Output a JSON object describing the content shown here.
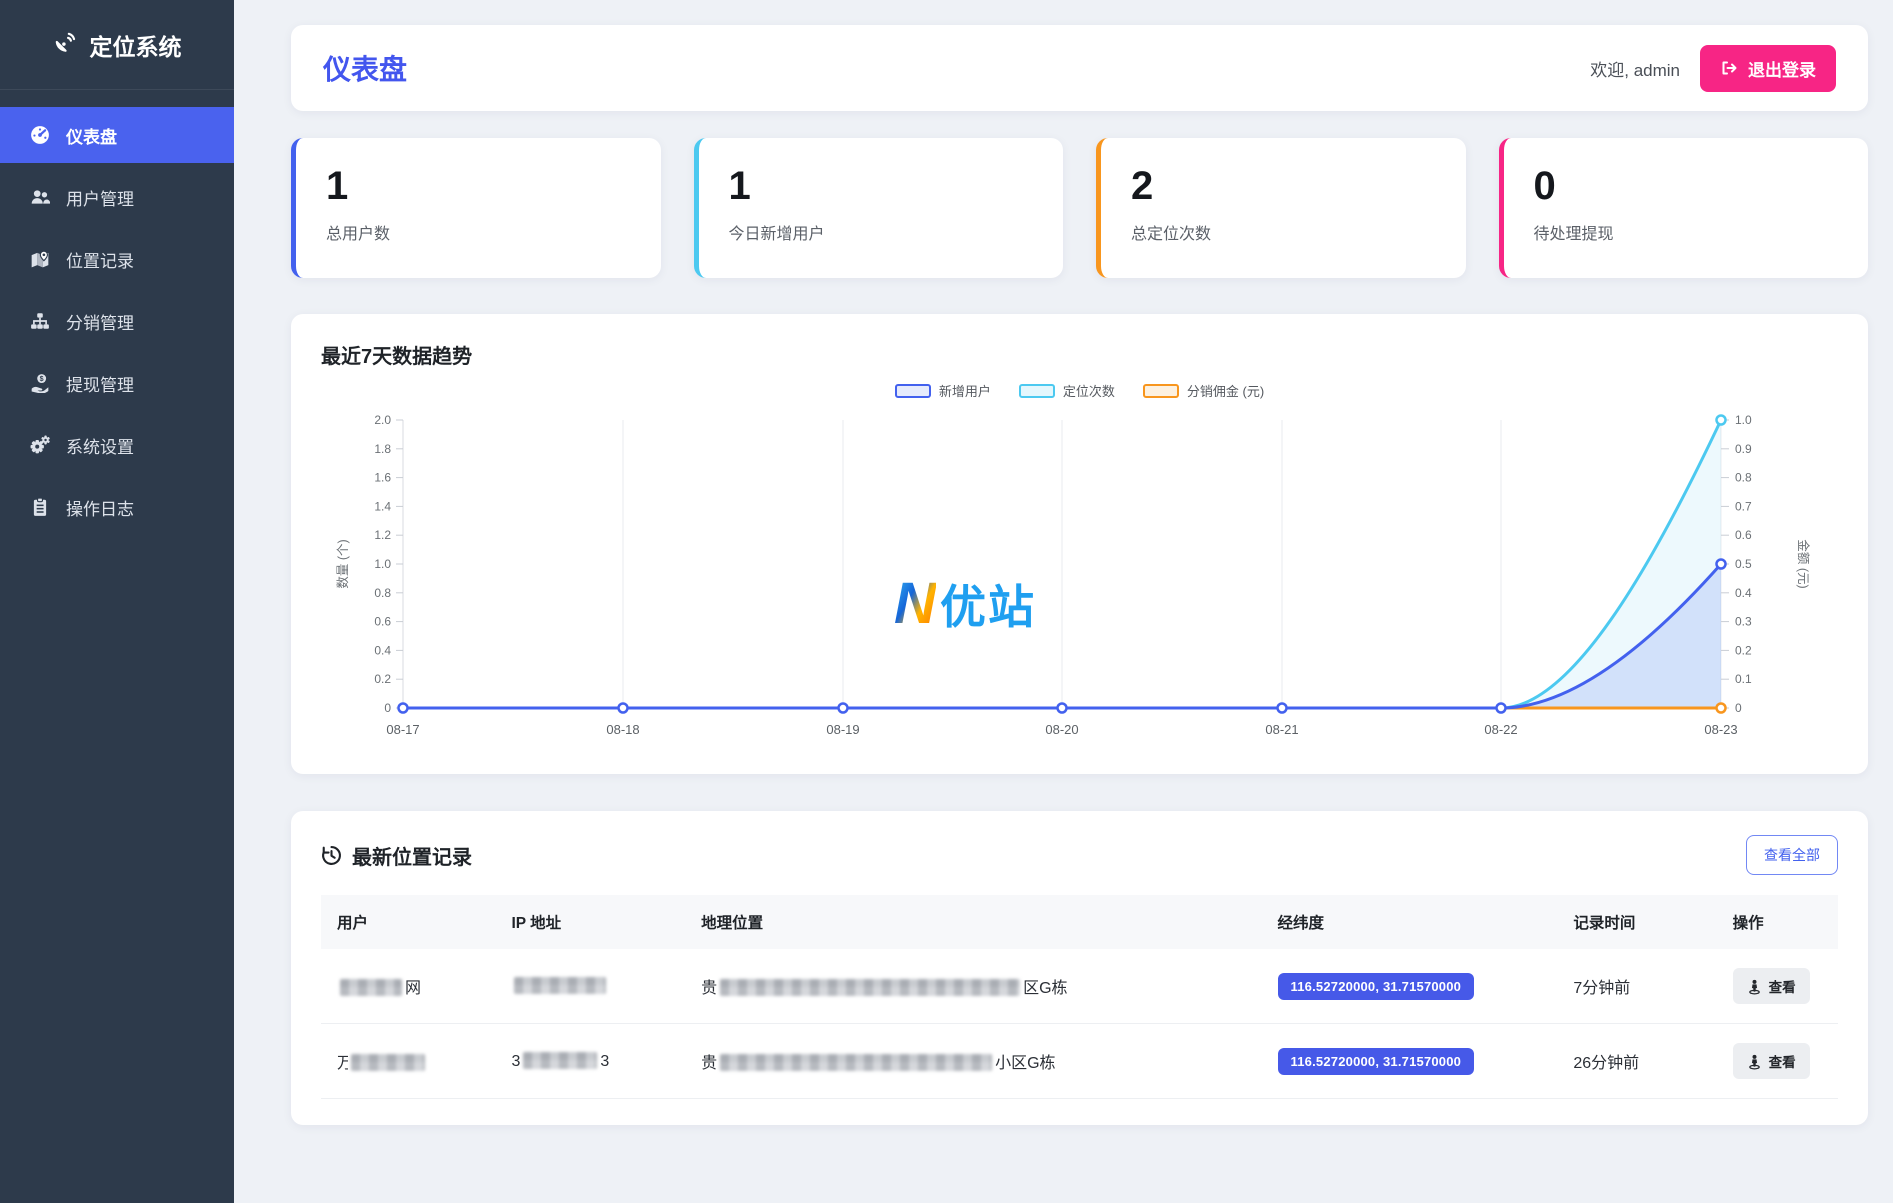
{
  "app": {
    "name": "定位系统",
    "logo_icon": "satellite-dish-icon"
  },
  "sidebar": {
    "items": [
      {
        "label": "仪表盘",
        "icon": "gauge-icon",
        "active": true
      },
      {
        "label": "用户管理",
        "icon": "users-icon",
        "active": false
      },
      {
        "label": "位置记录",
        "icon": "map-marker-icon",
        "active": false
      },
      {
        "label": "分销管理",
        "icon": "sitemap-icon",
        "active": false
      },
      {
        "label": "提现管理",
        "icon": "hand-holding-dollar-icon",
        "active": false
      },
      {
        "label": "系统设置",
        "icon": "gears-icon",
        "active": false
      },
      {
        "label": "操作日志",
        "icon": "clipboard-list-icon",
        "active": false
      }
    ]
  },
  "header": {
    "title": "仪表盘",
    "welcome": "欢迎, admin",
    "logout": "退出登录",
    "logout_icon": "sign-out-icon"
  },
  "stats": [
    {
      "value": "1",
      "label": "总用户数",
      "accent": "#4361ee"
    },
    {
      "value": "1",
      "label": "今日新增用户",
      "accent": "#4cc9f0"
    },
    {
      "value": "2",
      "label": "总定位次数",
      "accent": "#f8961e"
    },
    {
      "value": "0",
      "label": "待处理提现",
      "accent": "#f72585"
    }
  ],
  "chart": {
    "title": "最近7天数据趋势",
    "watermark": {
      "letter": "N",
      "text": "优站"
    },
    "chart_data": {
      "type": "line",
      "x": [
        "08-17",
        "08-18",
        "08-19",
        "08-20",
        "08-21",
        "08-22",
        "08-23"
      ],
      "series": [
        {
          "name": "新增用户",
          "color": "#4361ee",
          "axis": "left",
          "smooth": true,
          "area": true,
          "values": [
            0,
            0,
            0,
            0,
            0,
            0,
            1
          ]
        },
        {
          "name": "定位次数",
          "color": "#4cc9f0",
          "axis": "left",
          "smooth": true,
          "area": true,
          "values": [
            0,
            0,
            0,
            0,
            0,
            0,
            2
          ]
        },
        {
          "name": "分销佣金 (元)",
          "color": "#f8961e",
          "axis": "right",
          "smooth": true,
          "area": false,
          "values": [
            0,
            0,
            0,
            0,
            0,
            0,
            0
          ]
        }
      ],
      "y_axis_left": {
        "name": "数量 (个)",
        "min": 0,
        "max": 2,
        "ticks": [
          "2.0",
          "1.8",
          "1.6",
          "1.4",
          "1.2",
          "1.0",
          "0.8",
          "0.6",
          "0.4",
          "0.2",
          "0"
        ]
      },
      "y_axis_right": {
        "name": "金额 (元)",
        "min": 0,
        "max": 1,
        "ticks": [
          "1.0",
          "0.9",
          "0.8",
          "0.7",
          "0.6",
          "0.5",
          "0.4",
          "0.3",
          "0.2",
          "0.1",
          "0"
        ]
      },
      "legend_position": "top",
      "grid": "vertical-only"
    }
  },
  "records": {
    "title": "最新位置记录",
    "title_icon": "history-icon",
    "view_all": "查看全部",
    "action_icon": "street-view-icon",
    "columns": [
      "用户",
      "IP 地址",
      "地理位置",
      "经纬度",
      "记录时间",
      "操作"
    ],
    "rows": [
      {
        "user_prefix": "",
        "user_suffix": "网",
        "ip_prefix": "",
        "ip_suffix": "",
        "loc_prefix": "贵",
        "loc_suffix": "区G栋",
        "coords": "116.52720000, 31.71570000",
        "time": "7分钟前",
        "action": "查看"
      },
      {
        "user_prefix": "万",
        "user_suffix": "",
        "ip_prefix": "3",
        "ip_suffix": "3",
        "loc_prefix": "贵",
        "loc_suffix": "小区G栋",
        "coords": "116.52720000, 31.71570000",
        "time": "26分钟前",
        "action": "查看"
      }
    ]
  }
}
